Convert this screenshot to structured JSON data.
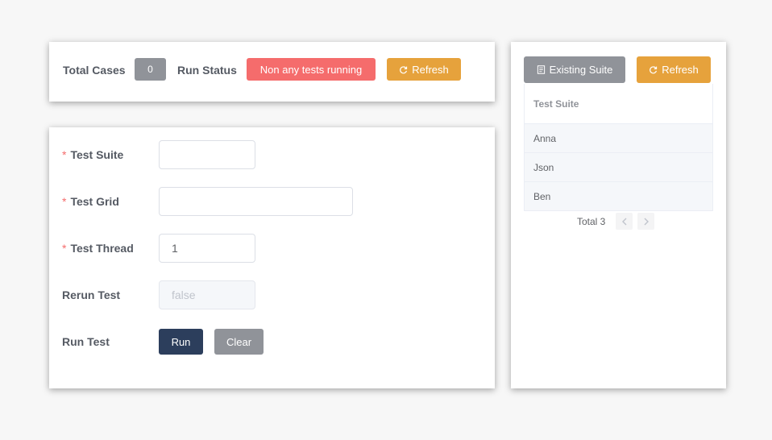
{
  "status_bar": {
    "total_cases_label": "Total Cases",
    "total_cases_value": "0",
    "run_status_label": "Run Status",
    "run_status_value": "Non any tests running",
    "refresh_label": "Refresh"
  },
  "form": {
    "test_suite": {
      "label": "Test Suite",
      "value": ""
    },
    "test_grid": {
      "label": "Test Grid",
      "value": ""
    },
    "test_thread": {
      "label": "Test Thread",
      "value": "1"
    },
    "rerun_test": {
      "label": "Rerun Test",
      "value": "false"
    },
    "run_test": {
      "label": "Run Test",
      "run_label": "Run",
      "clear_label": "Clear"
    },
    "required_mark": "*"
  },
  "suite_panel": {
    "existing_suite_label": "Existing Suite",
    "refresh_label": "Refresh",
    "table_header": "Test Suite",
    "rows": [
      "Anna",
      "Json",
      "Ben"
    ],
    "total_label": "Total 3"
  },
  "colors": {
    "danger": "#f56c6c",
    "warning": "#e6a23c",
    "info": "#909399",
    "primary_dark": "#2c3e5c"
  },
  "icons": {
    "refresh": "refresh-icon",
    "document": "document-icon",
    "prev": "chevron-left-icon",
    "next": "chevron-right-icon"
  }
}
